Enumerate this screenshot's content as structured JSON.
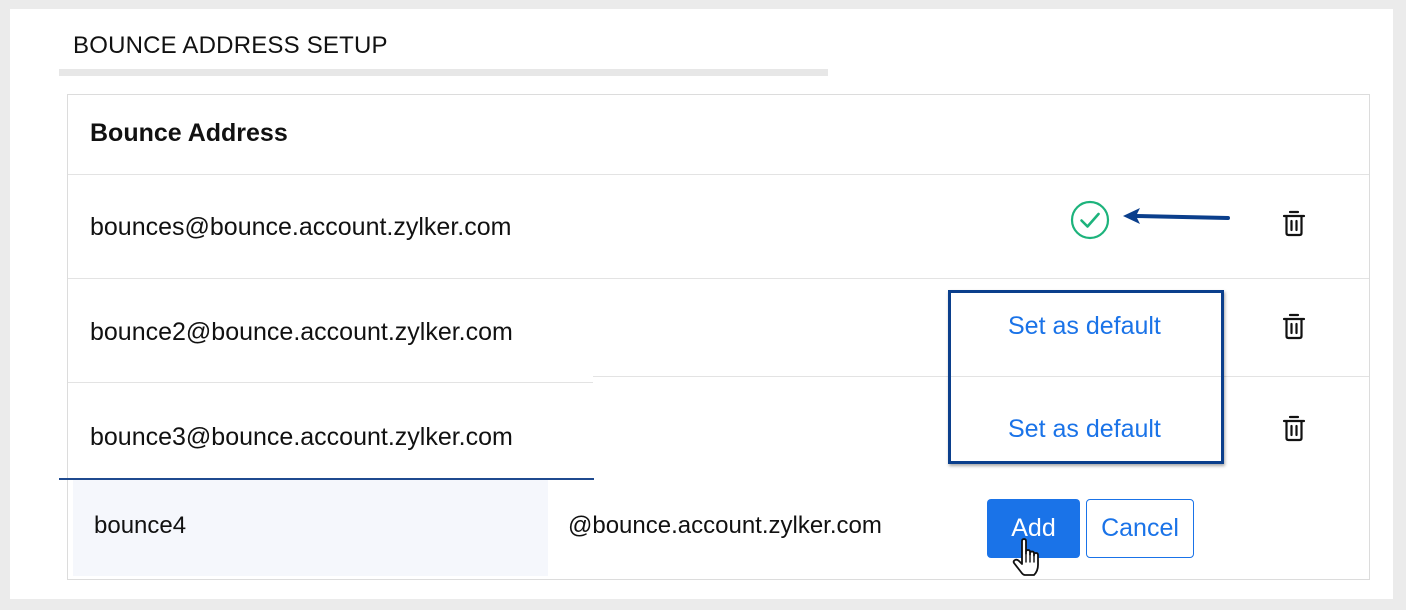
{
  "section": {
    "title": "BOUNCE ADDRESS SETUP"
  },
  "table": {
    "header": "Bounce Address",
    "rows": [
      {
        "address": "bounces@bounce.account.zylker.com",
        "status": "default",
        "status_icon": "check-circle-icon",
        "delete_icon": "trash-icon"
      },
      {
        "address": "bounce2@bounce.account.zylker.com",
        "action": "Set as default",
        "delete_icon": "trash-icon"
      },
      {
        "address": "bounce3@bounce.account.zylker.com",
        "action": "Set as default",
        "delete_icon": "trash-icon"
      }
    ]
  },
  "new_entry": {
    "value": "bounce4",
    "domain_suffix": "@bounce.account.zylker.com",
    "add_label": "Add",
    "cancel_label": "Cancel"
  },
  "annotation": {
    "arrow_icon": "left-arrow-icon",
    "highlight": "set-as-default-highlight",
    "cursor_icon": "hand-pointer-icon"
  },
  "colors": {
    "accent": "#1a73e8",
    "success": "#1db37c",
    "annotation": "#0b3f8c",
    "text": "#111111",
    "border": "#dcdcdc"
  }
}
